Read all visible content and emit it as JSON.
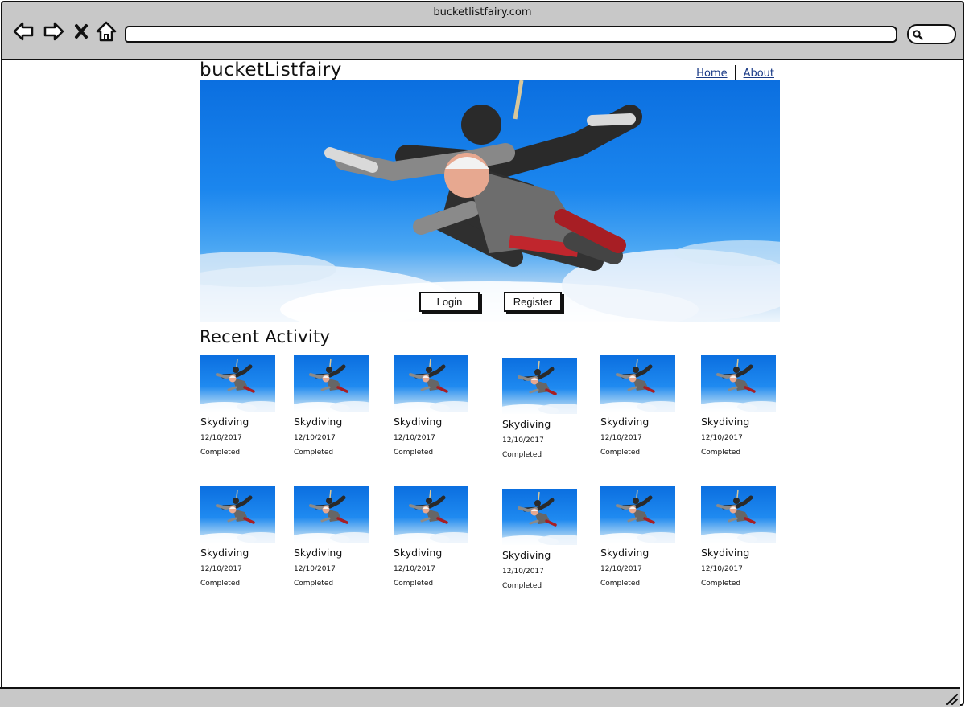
{
  "window": {
    "title": "bucketlistfairy.com"
  },
  "toolbar": {
    "back_icon": "back-arrow-icon",
    "forward_icon": "forward-arrow-icon",
    "stop_icon": "close-icon",
    "home_icon": "home-icon",
    "search_icon": "search-icon"
  },
  "site": {
    "brand": "bucketListfairy",
    "nav": [
      {
        "label": "Home"
      },
      {
        "label": "About"
      }
    ]
  },
  "hero": {
    "login_label": "Login",
    "register_label": "Register"
  },
  "activity": {
    "heading": "Recent Activity",
    "items": [
      {
        "title": "Skydiving",
        "date": "12/10/2017",
        "status": "Completed"
      },
      {
        "title": "Skydiving",
        "date": "12/10/2017",
        "status": "Completed"
      },
      {
        "title": "Skydiving",
        "date": "12/10/2017",
        "status": "Completed"
      },
      {
        "title": "Skydiving",
        "date": "12/10/2017",
        "status": "Completed"
      },
      {
        "title": "Skydiving",
        "date": "12/10/2017",
        "status": "Completed"
      },
      {
        "title": "Skydiving",
        "date": "12/10/2017",
        "status": "Completed"
      },
      {
        "title": "Skydiving",
        "date": "12/10/2017",
        "status": "Completed"
      },
      {
        "title": "Skydiving",
        "date": "12/10/2017",
        "status": "Completed"
      },
      {
        "title": "Skydiving",
        "date": "12/10/2017",
        "status": "Completed"
      },
      {
        "title": "Skydiving",
        "date": "12/10/2017",
        "status": "Completed"
      },
      {
        "title": "Skydiving",
        "date": "12/10/2017",
        "status": "Completed"
      },
      {
        "title": "Skydiving",
        "date": "12/10/2017",
        "status": "Completed"
      }
    ]
  }
}
